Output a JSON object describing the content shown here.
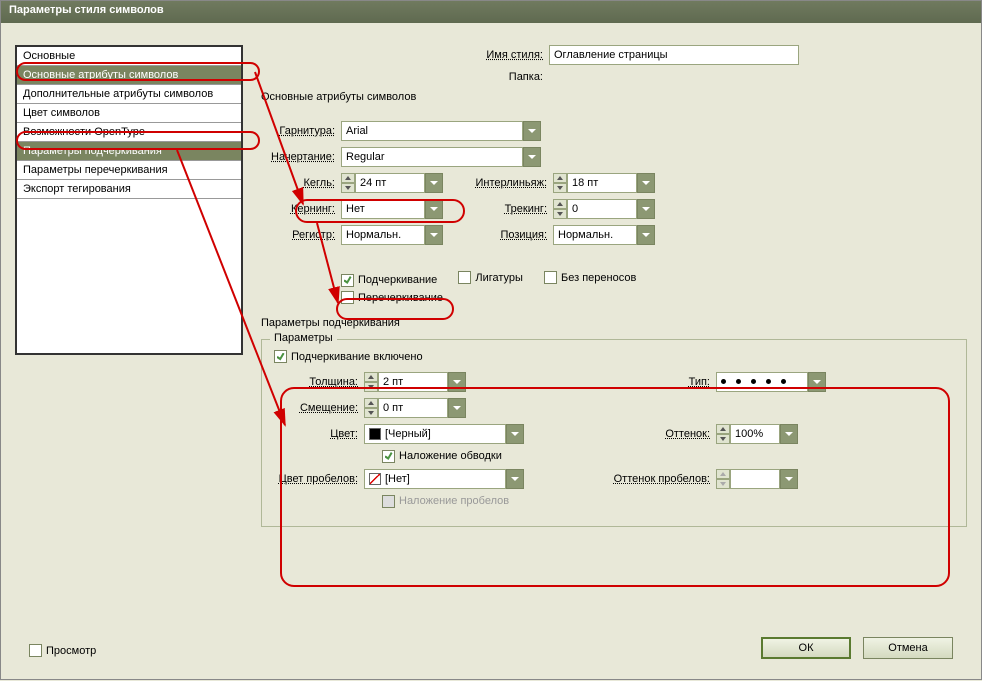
{
  "window": {
    "title": "Параметры стиля символов"
  },
  "sidebar": {
    "items": [
      "Основные",
      "Основные атрибуты символов",
      "Дополнительные атрибуты символов",
      "Цвет символов",
      "Возможности OpenType",
      "Параметры подчеркивания",
      "Параметры перечеркивания",
      "Экспорт тегирования"
    ],
    "selected_indices": [
      1,
      5
    ]
  },
  "header": {
    "style_name_label": "Имя стиля:",
    "style_name_value": "Оглавление страницы",
    "folder_label": "Папка:",
    "section_title": "Основные атрибуты символов"
  },
  "basic": {
    "font_label": "Гарнитура:",
    "font_value": "Arial",
    "style_label": "Начертание:",
    "style_value": "Regular",
    "size_label": "Кегль:",
    "size_value": "24 пт",
    "leading_label": "Интерлиньяж:",
    "leading_value": "18 пт",
    "kerning_label": "Кернинг:",
    "kerning_value": "Нет",
    "tracking_label": "Трекинг:",
    "tracking_value": "0",
    "case_label": "Регистр:",
    "case_value": "Нормальн.",
    "position_label": "Позиция:",
    "position_value": "Нормальн."
  },
  "checks": {
    "underline": "Подчеркивание",
    "ligatures": "Лигатуры",
    "nohyphen": "Без переносов",
    "strike": "Перечеркивание"
  },
  "underline_section": "Параметры подчеркивания",
  "group": {
    "legend": "Параметры",
    "enabled": "Подчеркивание включено",
    "weight_label": "Толщина:",
    "weight_value": "2 пт",
    "offset_label": "Смещение:",
    "offset_value": "0 пт",
    "type_label": "Тип:",
    "color_label": "Цвет:",
    "color_value": "[Черный]",
    "tint_label": "Оттенок:",
    "tint_value": "100%",
    "overprint_stroke": "Наложение обводки",
    "gap_color_label": "Цвет пробелов:",
    "gap_color_value": "[Нет]",
    "gap_tint_label": "Оттенок пробелов:",
    "overprint_gap": "Наложение пробелов"
  },
  "footer": {
    "preview": "Просмотр",
    "ok": "ОК",
    "cancel": "Отмена"
  }
}
